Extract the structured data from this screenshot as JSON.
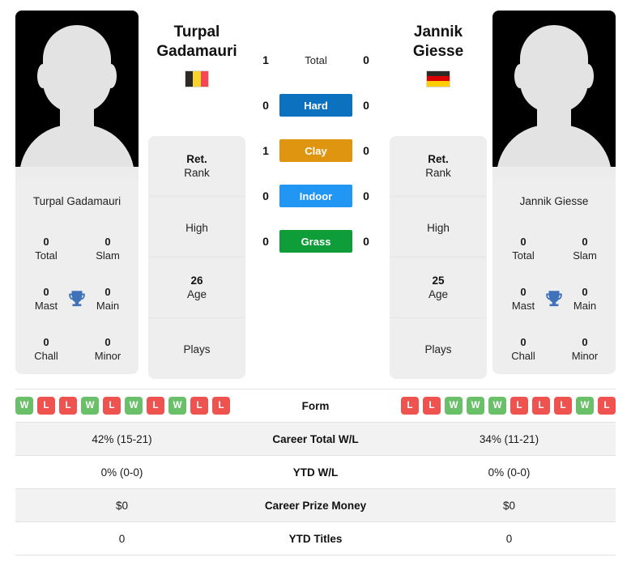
{
  "players": {
    "left": {
      "first_name": "Turpal",
      "last_name": "Gadamauri",
      "full_name": "Turpal Gadamauri",
      "country": "Belgium",
      "flag": "belgium-flag",
      "rank_value": "Ret.",
      "rank_label": "Rank",
      "high_value": "",
      "high_label": "High",
      "age_value": "26",
      "age_label": "Age",
      "plays_value": "",
      "plays_label": "Plays",
      "titles": [
        {
          "value": "0",
          "label": "Total"
        },
        {
          "value": "0",
          "label": "Slam"
        },
        {
          "value": "0",
          "label": "Mast"
        },
        {
          "value": "0",
          "label": "Main"
        },
        {
          "value": "0",
          "label": "Chall"
        },
        {
          "value": "0",
          "label": "Minor"
        }
      ],
      "form": [
        "W",
        "L",
        "L",
        "W",
        "L",
        "W",
        "L",
        "W",
        "L",
        "L"
      ],
      "career_total_wl": "42% (15-21)",
      "ytd_wl": "0% (0-0)",
      "career_prize_money": "$0",
      "ytd_titles": "0"
    },
    "right": {
      "first_name": "Jannik",
      "last_name": "Giesse",
      "full_name": "Jannik Giesse",
      "country": "Germany",
      "flag": "germany-flag",
      "rank_value": "Ret.",
      "rank_label": "Rank",
      "high_value": "",
      "high_label": "High",
      "age_value": "25",
      "age_label": "Age",
      "plays_value": "",
      "plays_label": "Plays",
      "titles": [
        {
          "value": "0",
          "label": "Total"
        },
        {
          "value": "0",
          "label": "Slam"
        },
        {
          "value": "0",
          "label": "Mast"
        },
        {
          "value": "0",
          "label": "Main"
        },
        {
          "value": "0",
          "label": "Chall"
        },
        {
          "value": "0",
          "label": "Minor"
        }
      ],
      "form": [
        "L",
        "L",
        "W",
        "W",
        "W",
        "L",
        "L",
        "L",
        "W",
        "L"
      ],
      "career_total_wl": "34% (11-21)",
      "ytd_wl": "0% (0-0)",
      "career_prize_money": "$0",
      "ytd_titles": "0"
    }
  },
  "h2h": {
    "surfaces": [
      {
        "name": "Total",
        "left": "1",
        "right": "0",
        "color": "",
        "text_color": "#222222"
      },
      {
        "name": "Hard",
        "left": "0",
        "right": "0",
        "color": "#0c72c0",
        "text_color": "#ffffff"
      },
      {
        "name": "Clay",
        "left": "1",
        "right": "0",
        "color": "#e09510",
        "text_color": "#ffffff"
      },
      {
        "name": "Indoor",
        "left": "0",
        "right": "0",
        "color": "#2196f3",
        "text_color": "#ffffff"
      },
      {
        "name": "Grass",
        "left": "0",
        "right": "0",
        "color": "#0f9d3a",
        "text_color": "#ffffff"
      }
    ]
  },
  "stats_table": {
    "rows": [
      {
        "label": "Form",
        "left": "",
        "right": "",
        "type": "form"
      },
      {
        "label": "Career Total W/L",
        "left": "42% (15-21)",
        "right": "34% (11-21)",
        "type": "text"
      },
      {
        "label": "YTD W/L",
        "left": "0% (0-0)",
        "right": "0% (0-0)",
        "type": "text"
      },
      {
        "label": "Career Prize Money",
        "left": "$0",
        "right": "$0",
        "type": "text"
      },
      {
        "label": "YTD Titles",
        "left": "0",
        "right": "0",
        "type": "text"
      }
    ]
  },
  "icons": {
    "trophy": "trophy-icon"
  },
  "colors": {
    "win": "#6abf69",
    "loss": "#ef5350",
    "hard": "#0c72c0",
    "clay": "#e09510",
    "indoor": "#2196f3",
    "grass": "#0f9d3a",
    "card_bg": "#eeeeee",
    "row_alt": "#f2f2f2"
  }
}
